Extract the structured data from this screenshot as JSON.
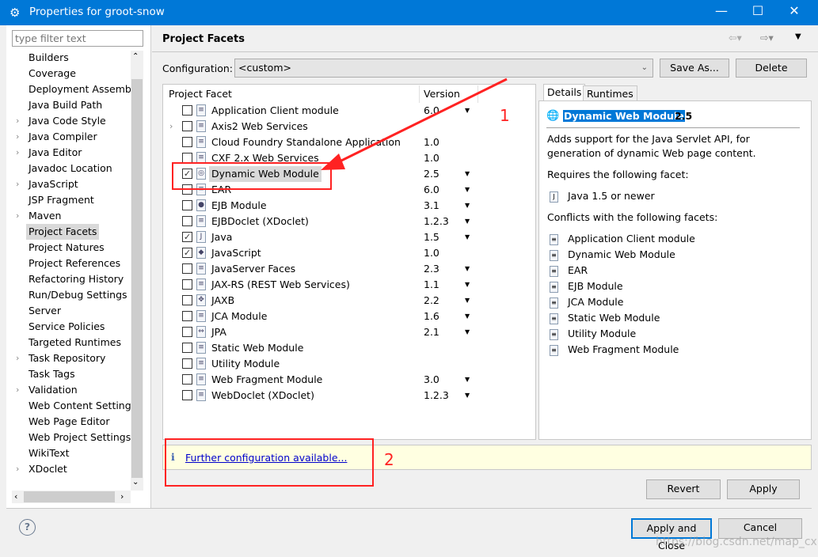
{
  "window": {
    "title": "Properties for groot-snow",
    "minimize": "—",
    "maximize": "☐",
    "close": "✕"
  },
  "sidebar": {
    "filter_placeholder": "type filter text",
    "selected": "Project Facets",
    "items": [
      {
        "label": "Builders",
        "expandable": false
      },
      {
        "label": "Coverage",
        "expandable": false
      },
      {
        "label": "Deployment Assembly",
        "expandable": false
      },
      {
        "label": "Java Build Path",
        "expandable": false
      },
      {
        "label": "Java Code Style",
        "expandable": true
      },
      {
        "label": "Java Compiler",
        "expandable": true
      },
      {
        "label": "Java Editor",
        "expandable": true
      },
      {
        "label": "Javadoc Location",
        "expandable": false
      },
      {
        "label": "JavaScript",
        "expandable": true
      },
      {
        "label": "JSP Fragment",
        "expandable": false
      },
      {
        "label": "Maven",
        "expandable": true
      },
      {
        "label": "Project Facets",
        "expandable": false
      },
      {
        "label": "Project Natures",
        "expandable": false
      },
      {
        "label": "Project References",
        "expandable": false
      },
      {
        "label": "Refactoring History",
        "expandable": false
      },
      {
        "label": "Run/Debug Settings",
        "expandable": false
      },
      {
        "label": "Server",
        "expandable": false
      },
      {
        "label": "Service Policies",
        "expandable": false
      },
      {
        "label": "Targeted Runtimes",
        "expandable": false
      },
      {
        "label": "Task Repository",
        "expandable": true
      },
      {
        "label": "Task Tags",
        "expandable": false
      },
      {
        "label": "Validation",
        "expandable": true
      },
      {
        "label": "Web Content Settings",
        "expandable": false
      },
      {
        "label": "Web Page Editor",
        "expandable": false
      },
      {
        "label": "Web Project Settings",
        "expandable": false
      },
      {
        "label": "WikiText",
        "expandable": false
      },
      {
        "label": "XDoclet",
        "expandable": true
      }
    ]
  },
  "header": {
    "title": "Project Facets"
  },
  "config": {
    "label": "Configuration:",
    "value": "<custom>",
    "save_as": "Save As...",
    "delete": "Delete"
  },
  "facets": {
    "col_facet": "Project Facet",
    "col_version": "Version",
    "rows": [
      {
        "name": "Application Client module",
        "checked": false,
        "version": "6.0",
        "dropdown": true,
        "icon": "doc-icon"
      },
      {
        "name": "Axis2 Web Services",
        "checked": false,
        "version": "",
        "dropdown": false,
        "expandable": true,
        "icon": "doc-icon"
      },
      {
        "name": "Cloud Foundry Standalone Application",
        "checked": false,
        "version": "1.0",
        "dropdown": false,
        "icon": "doc-icon"
      },
      {
        "name": "CXF 2.x Web Services",
        "checked": false,
        "version": "1.0",
        "dropdown": false,
        "icon": "doc-icon"
      },
      {
        "name": "Dynamic Web Module",
        "checked": true,
        "version": "2.5",
        "dropdown": true,
        "selected": true,
        "icon": "web-module-icon"
      },
      {
        "name": "EAR",
        "checked": false,
        "version": "6.0",
        "dropdown": true,
        "icon": "doc-icon"
      },
      {
        "name": "EJB Module",
        "checked": false,
        "version": "3.1",
        "dropdown": true,
        "icon": "ejb-icon"
      },
      {
        "name": "EJBDoclet (XDoclet)",
        "checked": false,
        "version": "1.2.3",
        "dropdown": true,
        "icon": "doc-icon"
      },
      {
        "name": "Java",
        "checked": true,
        "version": "1.5",
        "dropdown": true,
        "icon": "java-icon"
      },
      {
        "name": "JavaScript",
        "checked": true,
        "version": "1.0",
        "dropdown": false,
        "icon": "javascript-icon"
      },
      {
        "name": "JavaServer Faces",
        "checked": false,
        "version": "2.3",
        "dropdown": true,
        "icon": "doc-icon"
      },
      {
        "name": "JAX-RS (REST Web Services)",
        "checked": false,
        "version": "1.1",
        "dropdown": true,
        "icon": "doc-icon"
      },
      {
        "name": "JAXB",
        "checked": false,
        "version": "2.2",
        "dropdown": true,
        "icon": "jaxb-icon"
      },
      {
        "name": "JCA Module",
        "checked": false,
        "version": "1.6",
        "dropdown": true,
        "icon": "doc-icon"
      },
      {
        "name": "JPA",
        "checked": false,
        "version": "2.1",
        "dropdown": true,
        "icon": "jpa-icon"
      },
      {
        "name": "Static Web Module",
        "checked": false,
        "version": "",
        "dropdown": false,
        "icon": "doc-icon"
      },
      {
        "name": "Utility Module",
        "checked": false,
        "version": "",
        "dropdown": false,
        "icon": "doc-icon"
      },
      {
        "name": "Web Fragment Module",
        "checked": false,
        "version": "3.0",
        "dropdown": true,
        "icon": "doc-icon"
      },
      {
        "name": "WebDoclet (XDoclet)",
        "checked": false,
        "version": "1.2.3",
        "dropdown": true,
        "icon": "doc-icon"
      }
    ]
  },
  "details": {
    "tab_details": "Details",
    "tab_runtimes": "Runtimes",
    "title": "Dynamic Web Module",
    "version": "2.5",
    "desc1": "Adds support for the Java Servlet API, for",
    "desc2": "generation of dynamic Web page content.",
    "requires_label": "Requires the following facet:",
    "requires": [
      "Java 1.5 or newer"
    ],
    "conflicts_label": "Conflicts with the following facets:",
    "conflicts": [
      "Application Client module",
      "Dynamic Web Module",
      "EAR",
      "EJB Module",
      "JCA Module",
      "Static Web Module",
      "Utility Module",
      "Web Fragment Module"
    ]
  },
  "info": {
    "icon": "info-icon",
    "link": "Further configuration available..."
  },
  "buttons": {
    "revert": "Revert",
    "apply": "Apply",
    "apply_close": "Apply and Close",
    "cancel": "Cancel",
    "help": "?"
  },
  "annotations": {
    "n1": "1",
    "n2": "2",
    "color": "#ff2222"
  },
  "watermark": "https://blog.csdn.net/map_cx",
  "colors": {
    "titlebar": "#0078d7",
    "selection": "#0078d7"
  }
}
